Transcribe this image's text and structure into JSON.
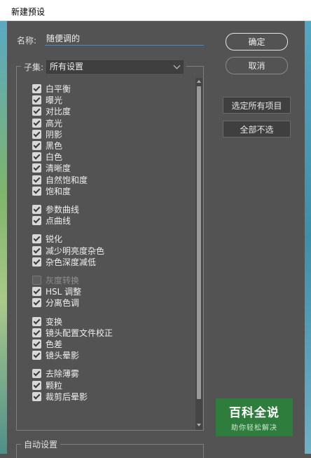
{
  "window": {
    "title": "新建预设"
  },
  "name_field": {
    "label": "名称:",
    "value": "随便调的"
  },
  "buttons": {
    "ok": "确定",
    "cancel": "取消",
    "select_all": "选定所有项目",
    "select_none": "全部不选"
  },
  "subset": {
    "label": "子集:",
    "selected": "所有设置"
  },
  "items": [
    {
      "label": "白平衡",
      "checked": true,
      "enabled": true
    },
    {
      "label": "曝光",
      "checked": true,
      "enabled": true
    },
    {
      "label": "对比度",
      "checked": true,
      "enabled": true
    },
    {
      "label": "高光",
      "checked": true,
      "enabled": true
    },
    {
      "label": "阴影",
      "checked": true,
      "enabled": true
    },
    {
      "label": "黑色",
      "checked": true,
      "enabled": true
    },
    {
      "label": "白色",
      "checked": true,
      "enabled": true
    },
    {
      "label": "清晰度",
      "checked": true,
      "enabled": true
    },
    {
      "label": "自然饱和度",
      "checked": true,
      "enabled": true
    },
    {
      "label": "饱和度",
      "checked": true,
      "enabled": true
    },
    {
      "label": "参数曲线",
      "checked": true,
      "enabled": true
    },
    {
      "label": "点曲线",
      "checked": true,
      "enabled": true
    },
    {
      "label": "锐化",
      "checked": true,
      "enabled": true
    },
    {
      "label": "减少明亮度杂色",
      "checked": true,
      "enabled": true
    },
    {
      "label": "杂色深度减低",
      "checked": true,
      "enabled": true
    },
    {
      "label": "灰度转换",
      "checked": false,
      "enabled": false
    },
    {
      "label": "HSL 调整",
      "checked": true,
      "enabled": true
    },
    {
      "label": "分离色调",
      "checked": true,
      "enabled": true
    },
    {
      "label": "变换",
      "checked": true,
      "enabled": true
    },
    {
      "label": "镜头配置文件校正",
      "checked": true,
      "enabled": true
    },
    {
      "label": "色差",
      "checked": true,
      "enabled": true
    },
    {
      "label": "镜头晕影",
      "checked": true,
      "enabled": true
    },
    {
      "label": "去除薄雾",
      "checked": true,
      "enabled": true
    },
    {
      "label": "颗粒",
      "checked": true,
      "enabled": true
    },
    {
      "label": "裁剪后晕影",
      "checked": true,
      "enabled": true
    }
  ],
  "auto_section": {
    "label": "自动设置"
  },
  "watermark": {
    "title": "百科全说",
    "subtitle": "助你轻松解决"
  }
}
